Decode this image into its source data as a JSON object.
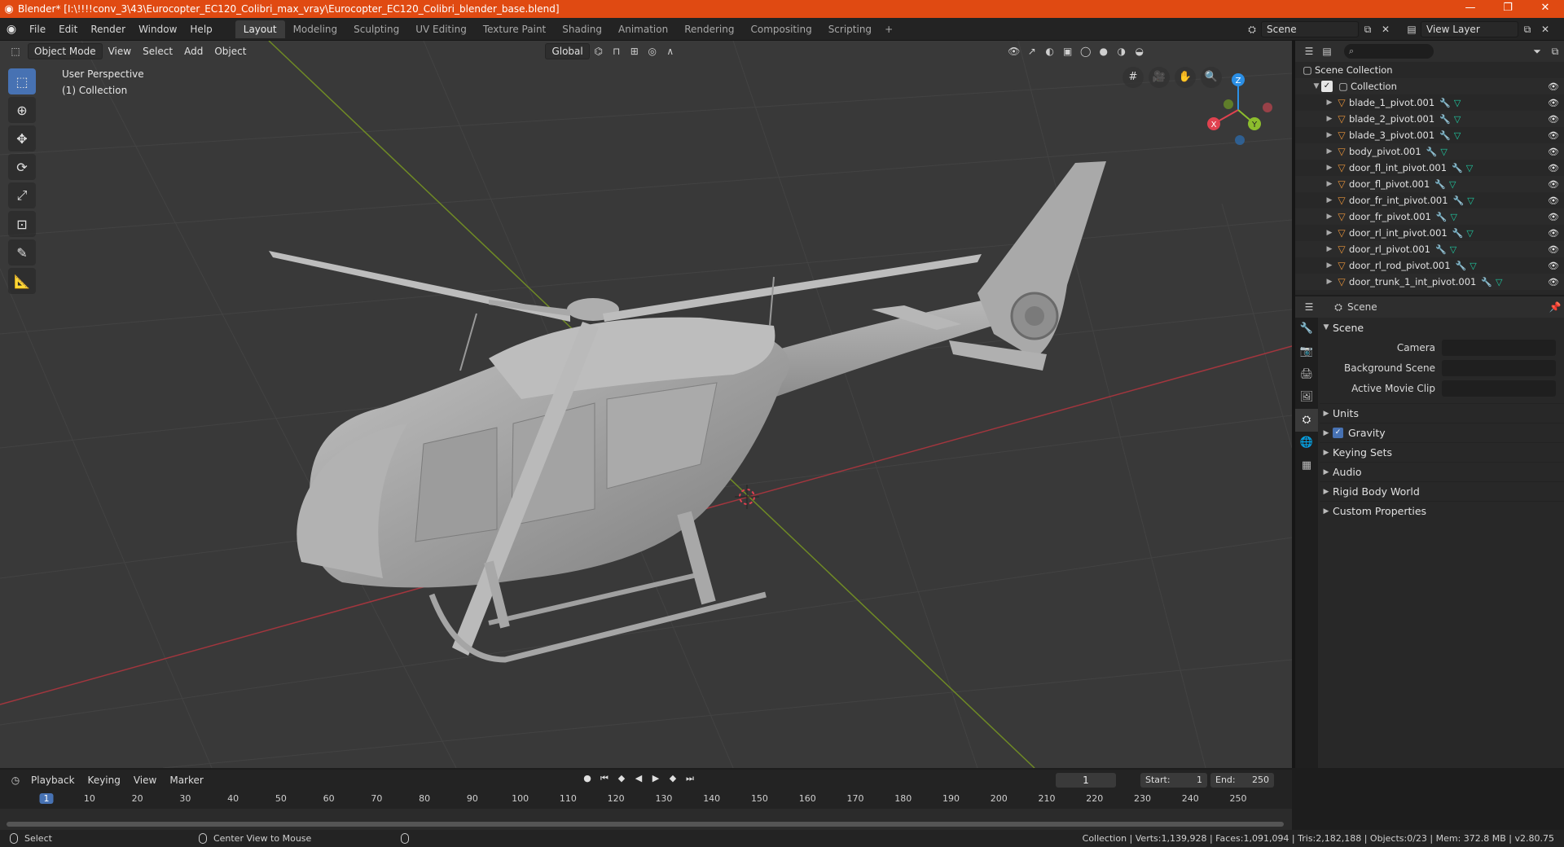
{
  "window": {
    "title": "Blender* [I:\\!!!!conv_3\\43\\Eurocopter_EC120_Colibri_max_vray\\Eurocopter_EC120_Colibri_blender_base.blend]",
    "minimize": "—",
    "maximize": "❐",
    "close": "✕"
  },
  "menus": [
    "File",
    "Edit",
    "Render",
    "Window",
    "Help"
  ],
  "workspaces": [
    {
      "label": "Layout",
      "active": true
    },
    {
      "label": "Modeling"
    },
    {
      "label": "Sculpting"
    },
    {
      "label": "UV Editing"
    },
    {
      "label": "Texture Paint"
    },
    {
      "label": "Shading"
    },
    {
      "label": "Animation"
    },
    {
      "label": "Rendering"
    },
    {
      "label": "Compositing"
    },
    {
      "label": "Scripting"
    }
  ],
  "topbar": {
    "scene_name": "Scene",
    "view_layer": "View Layer",
    "add_tab": "+"
  },
  "viewport": {
    "mode": "Object Mode",
    "menus": [
      "View",
      "Select",
      "Add",
      "Object"
    ],
    "orientation": "Global",
    "perspective_label": "User Perspective",
    "collection_label": "(1) Collection",
    "gizmo_axes": {
      "x": "X",
      "y": "Y",
      "z": "Z"
    }
  },
  "outliner": {
    "search_placeholder": "⌕",
    "root": "Scene Collection",
    "collection": "Collection",
    "items": [
      "blade_1_pivot.001",
      "blade_2_pivot.001",
      "blade_3_pivot.001",
      "body_pivot.001",
      "door_fl_int_pivot.001",
      "door_fl_pivot.001",
      "door_fr_int_pivot.001",
      "door_fr_pivot.001",
      "door_rl_int_pivot.001",
      "door_rl_pivot.001",
      "door_rl_rod_pivot.001",
      "door_trunk_1_int_pivot.001"
    ]
  },
  "properties": {
    "header_title": "Scene",
    "panel_title": "Scene",
    "fields": [
      {
        "label": "Camera",
        "value": ""
      },
      {
        "label": "Background Scene",
        "value": ""
      },
      {
        "label": "Active Movie Clip",
        "value": ""
      }
    ],
    "subpanels": [
      "Units",
      "Gravity",
      "Keying Sets",
      "Audio",
      "Rigid Body World",
      "Custom Properties"
    ]
  },
  "timeline": {
    "menus": [
      "Playback",
      "Keying",
      "View",
      "Marker"
    ],
    "current_frame": "1",
    "start_label": "Start:",
    "start_value": "1",
    "end_label": "End:",
    "end_value": "250",
    "ruler": [
      "1",
      "10",
      "20",
      "30",
      "40",
      "50",
      "60",
      "70",
      "80",
      "90",
      "100",
      "110",
      "120",
      "130",
      "140",
      "150",
      "160",
      "170",
      "180",
      "190",
      "200",
      "210",
      "220",
      "230",
      "240",
      "250"
    ]
  },
  "status": {
    "left_action": "Select",
    "middle_action": "Center View to Mouse",
    "stats": "Collection | Verts:1,139,928 | Faces:1,091,094 | Tris:2,182,188 | Objects:0/23 | Mem: 372.8 MB | v2.80.75"
  },
  "colors": {
    "title_bar": "#e04a12",
    "accent": "#4772b3",
    "object_icon": "#e6923a",
    "modifier_icon": "#6aa1e6",
    "mesh_icon": "#1fc9a0",
    "axis_x": "#e0424f",
    "axis_y": "#8cbd2d",
    "axis_z": "#2b8fe6"
  }
}
